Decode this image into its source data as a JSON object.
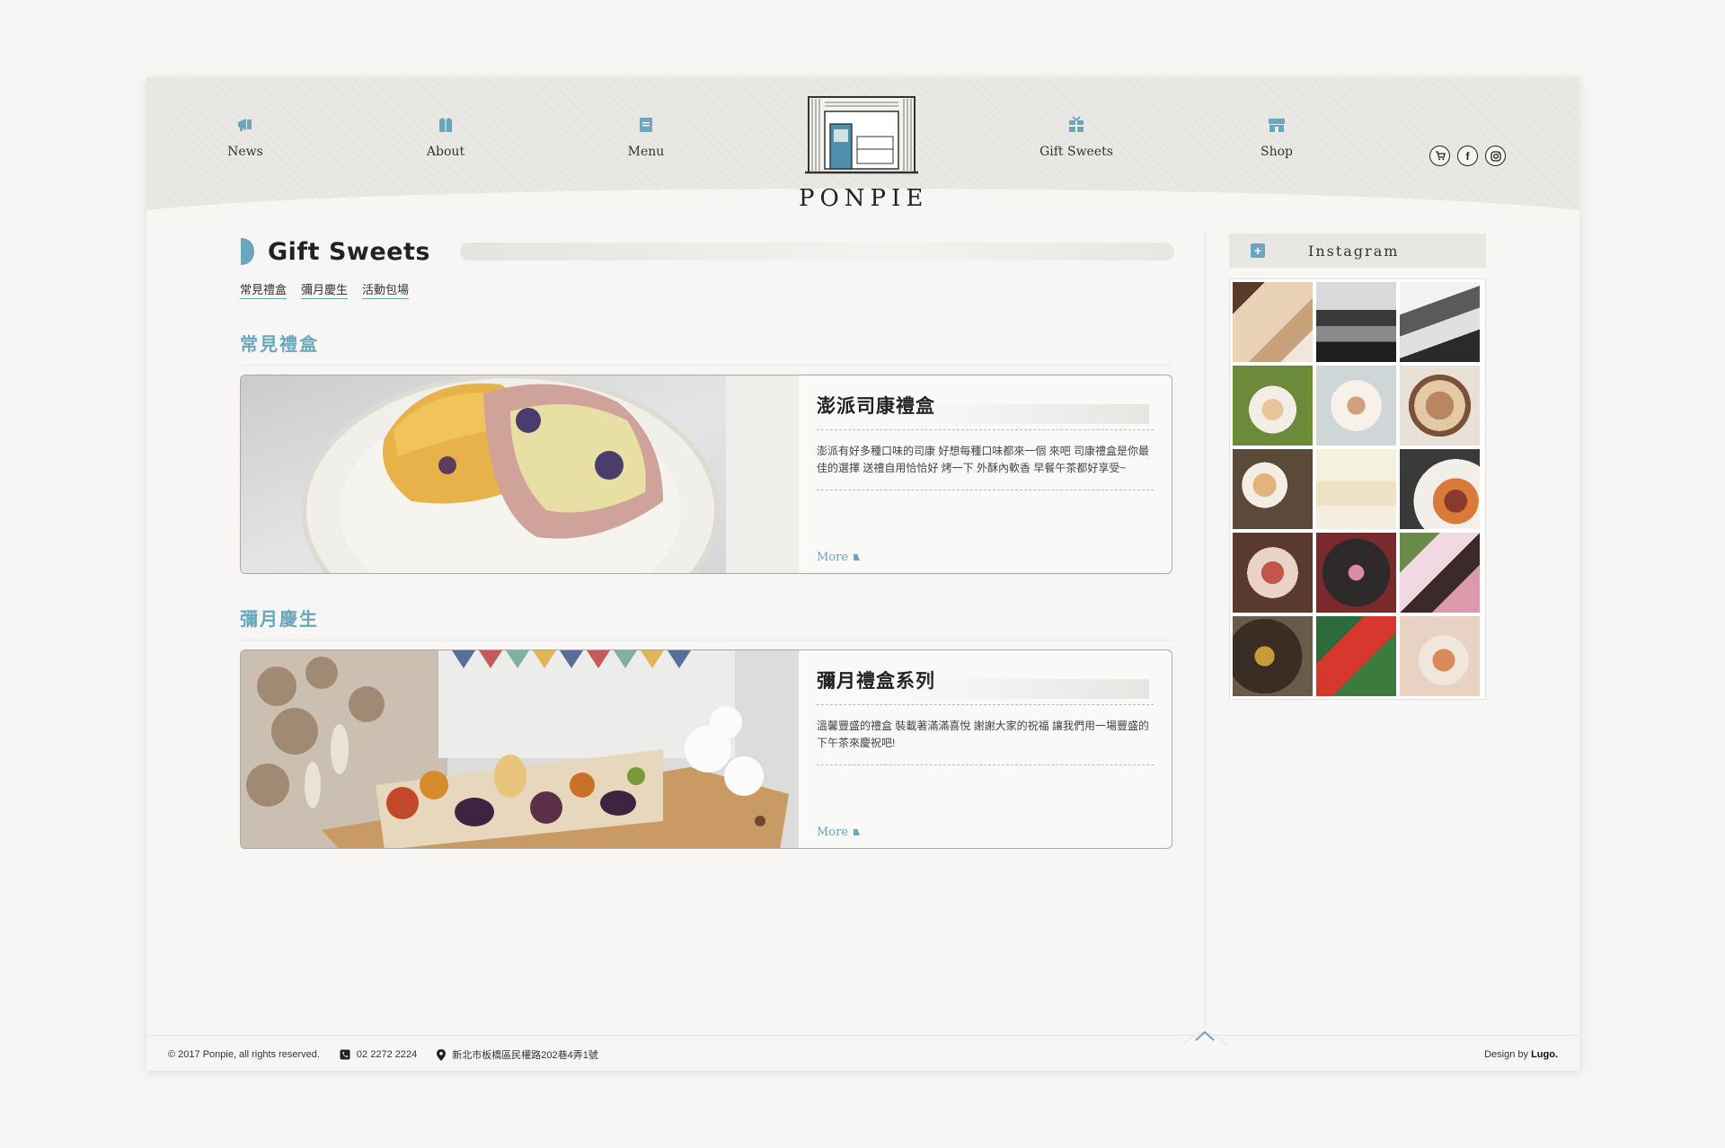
{
  "header": {
    "nav": [
      {
        "label": "News",
        "icon": "megaphone-icon"
      },
      {
        "label": "About",
        "icon": "shirt-icon"
      },
      {
        "label": "Menu",
        "icon": "menu-book-icon"
      },
      {
        "label": "Gift Sweets",
        "icon": "gift-box-icon"
      },
      {
        "label": "Shop",
        "icon": "storefront-icon"
      }
    ],
    "logo_text": "PONPIE",
    "social": [
      {
        "name": "cart-icon"
      },
      {
        "name": "facebook-icon",
        "glyph": "f"
      },
      {
        "name": "instagram-icon"
      }
    ]
  },
  "main": {
    "title": "Gift Sweets",
    "subnav": [
      "常見禮盒",
      "彌月慶生",
      "活動包場"
    ],
    "sections": [
      {
        "heading": "常見禮盒",
        "card": {
          "title": "澎派司康禮盒",
          "description": "澎派有好多種口味的司康 好想每種口味都來一個 來吧 司康禮盒是你最佳的選擇 送禮自用恰恰好 烤一下 外酥內軟香 早餐午茶都好享受~",
          "more": "More"
        }
      },
      {
        "heading": "彌月慶生",
        "card": {
          "title": "彌月禮盒系列",
          "description": "溫馨豐盛的禮盒 裝載著滿滿喜悅 謝謝大家的祝福 讓我們用一場豐盛的下午茶來慶祝吧!",
          "more": "More"
        }
      }
    ]
  },
  "sidebar": {
    "title": "Instagram",
    "photo_count": 15
  },
  "footer": {
    "copyright": "© 2017 Ponpie, all rights reserved.",
    "phone": "02 2272 2224",
    "address": "新北市板橋區民權路202巷4弄1號",
    "design_prefix": "Design by",
    "design_name": "Lugo."
  },
  "colors": {
    "accent": "#6aa7bd",
    "text": "#333333",
    "page_bg": "#f7f6f4"
  }
}
